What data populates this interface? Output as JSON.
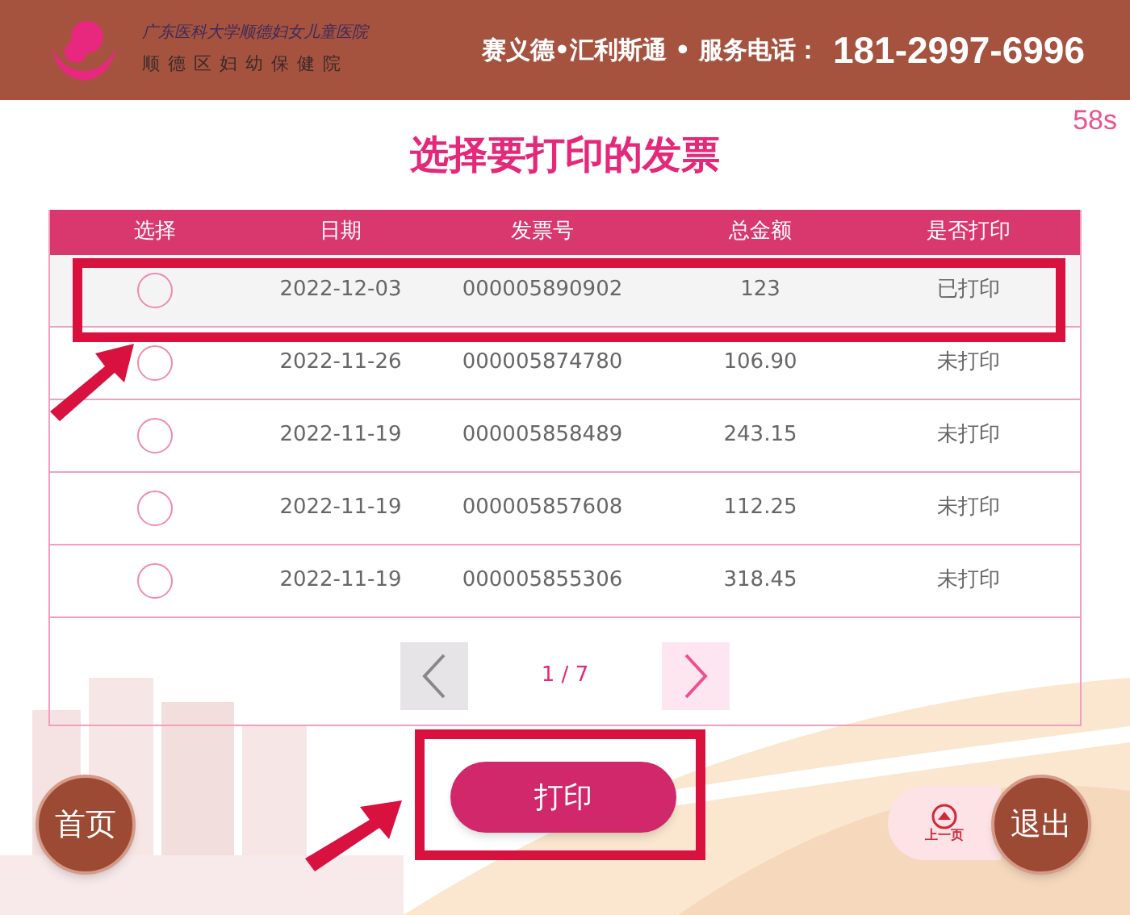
{
  "header": {
    "logo_line_1": "广东医科大学顺德妇女儿童医院",
    "logo_line_2": "顺德区妇幼保健院",
    "vendor": "赛义德•汇利斯通 • 服务电话：",
    "phone": "181-2997-6996"
  },
  "countdown": "58s",
  "title": "选择要打印的发票",
  "table": {
    "columns": [
      "选择",
      "日期",
      "发票号",
      "总金额",
      "是否打印"
    ],
    "rows": [
      {
        "selected": false,
        "highlighted": true,
        "date": "2022-12-03",
        "invoice": "000005890902",
        "amount": "123",
        "printed": "已打印"
      },
      {
        "selected": false,
        "highlighted": false,
        "date": "2022-11-26",
        "invoice": "000005874780",
        "amount": "106.90",
        "printed": "未打印"
      },
      {
        "selected": false,
        "highlighted": false,
        "date": "2022-11-19",
        "invoice": "000005858489",
        "amount": "243.15",
        "printed": "未打印"
      },
      {
        "selected": false,
        "highlighted": false,
        "date": "2022-11-19",
        "invoice": "000005857608",
        "amount": "112.25",
        "printed": "未打印"
      },
      {
        "selected": false,
        "highlighted": false,
        "date": "2022-11-19",
        "invoice": "000005855306",
        "amount": "318.45",
        "printed": "未打印"
      }
    ]
  },
  "pager": {
    "page": "1 / 7"
  },
  "buttons": {
    "home": "首页",
    "print": "打印",
    "print_highlighted": true,
    "prev_page": "上一页",
    "exit": "退出"
  }
}
